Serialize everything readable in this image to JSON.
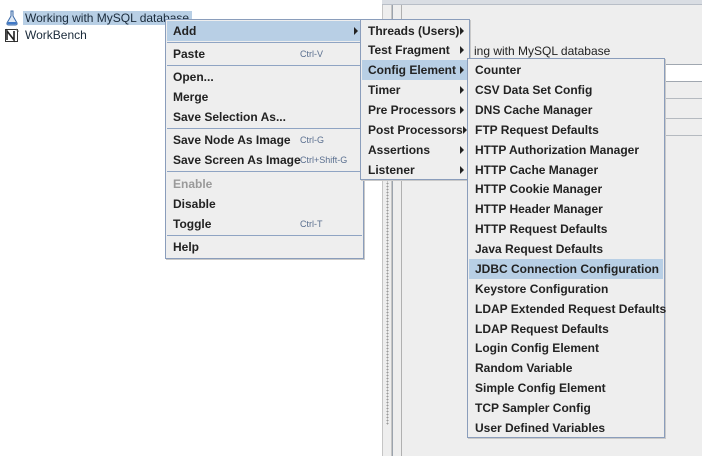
{
  "tree": {
    "testplan_label": "Working with MySQL database",
    "workbench_label": "WorkBench"
  },
  "right_panel": {
    "title_fragment": "ing with MySQL database"
  },
  "context_menu": {
    "add": "Add",
    "paste": "Paste",
    "paste_shortcut": "Ctrl-V",
    "open": "Open...",
    "merge": "Merge",
    "save_selection": "Save Selection As...",
    "save_node_image": "Save Node As Image",
    "save_node_image_shortcut": "Ctrl-G",
    "save_screen_image": "Save Screen As Image",
    "save_screen_image_shortcut": "Ctrl+Shift-G",
    "enable": "Enable",
    "disable": "Disable",
    "toggle": "Toggle",
    "toggle_shortcut": "Ctrl-T",
    "help": "Help"
  },
  "add_menu": [
    "Threads (Users)",
    "Test Fragment",
    "Config Element",
    "Timer",
    "Pre Processors",
    "Post Processors",
    "Assertions",
    "Listener"
  ],
  "config_menu": [
    "Counter",
    "CSV Data Set Config",
    "DNS Cache Manager",
    "FTP Request Defaults",
    "HTTP Authorization Manager",
    "HTTP Cache Manager",
    "HTTP Cookie Manager",
    "HTTP Header Manager",
    "HTTP Request Defaults",
    "Java Request Defaults",
    "JDBC Connection Configuration",
    "Keystore Configuration",
    "LDAP Extended Request Defaults",
    "LDAP Request Defaults",
    "Login Config Element",
    "Random Variable",
    "Simple Config Element",
    "TCP Sampler Config",
    "User Defined Variables"
  ],
  "highlighted": {
    "add_menu": "Config Element",
    "config_menu": "JDBC Connection Configuration"
  },
  "colors": {
    "selection": "#b8cfe5",
    "menu_background": "#eeeeee",
    "menu_border": "#8a9dbb"
  }
}
